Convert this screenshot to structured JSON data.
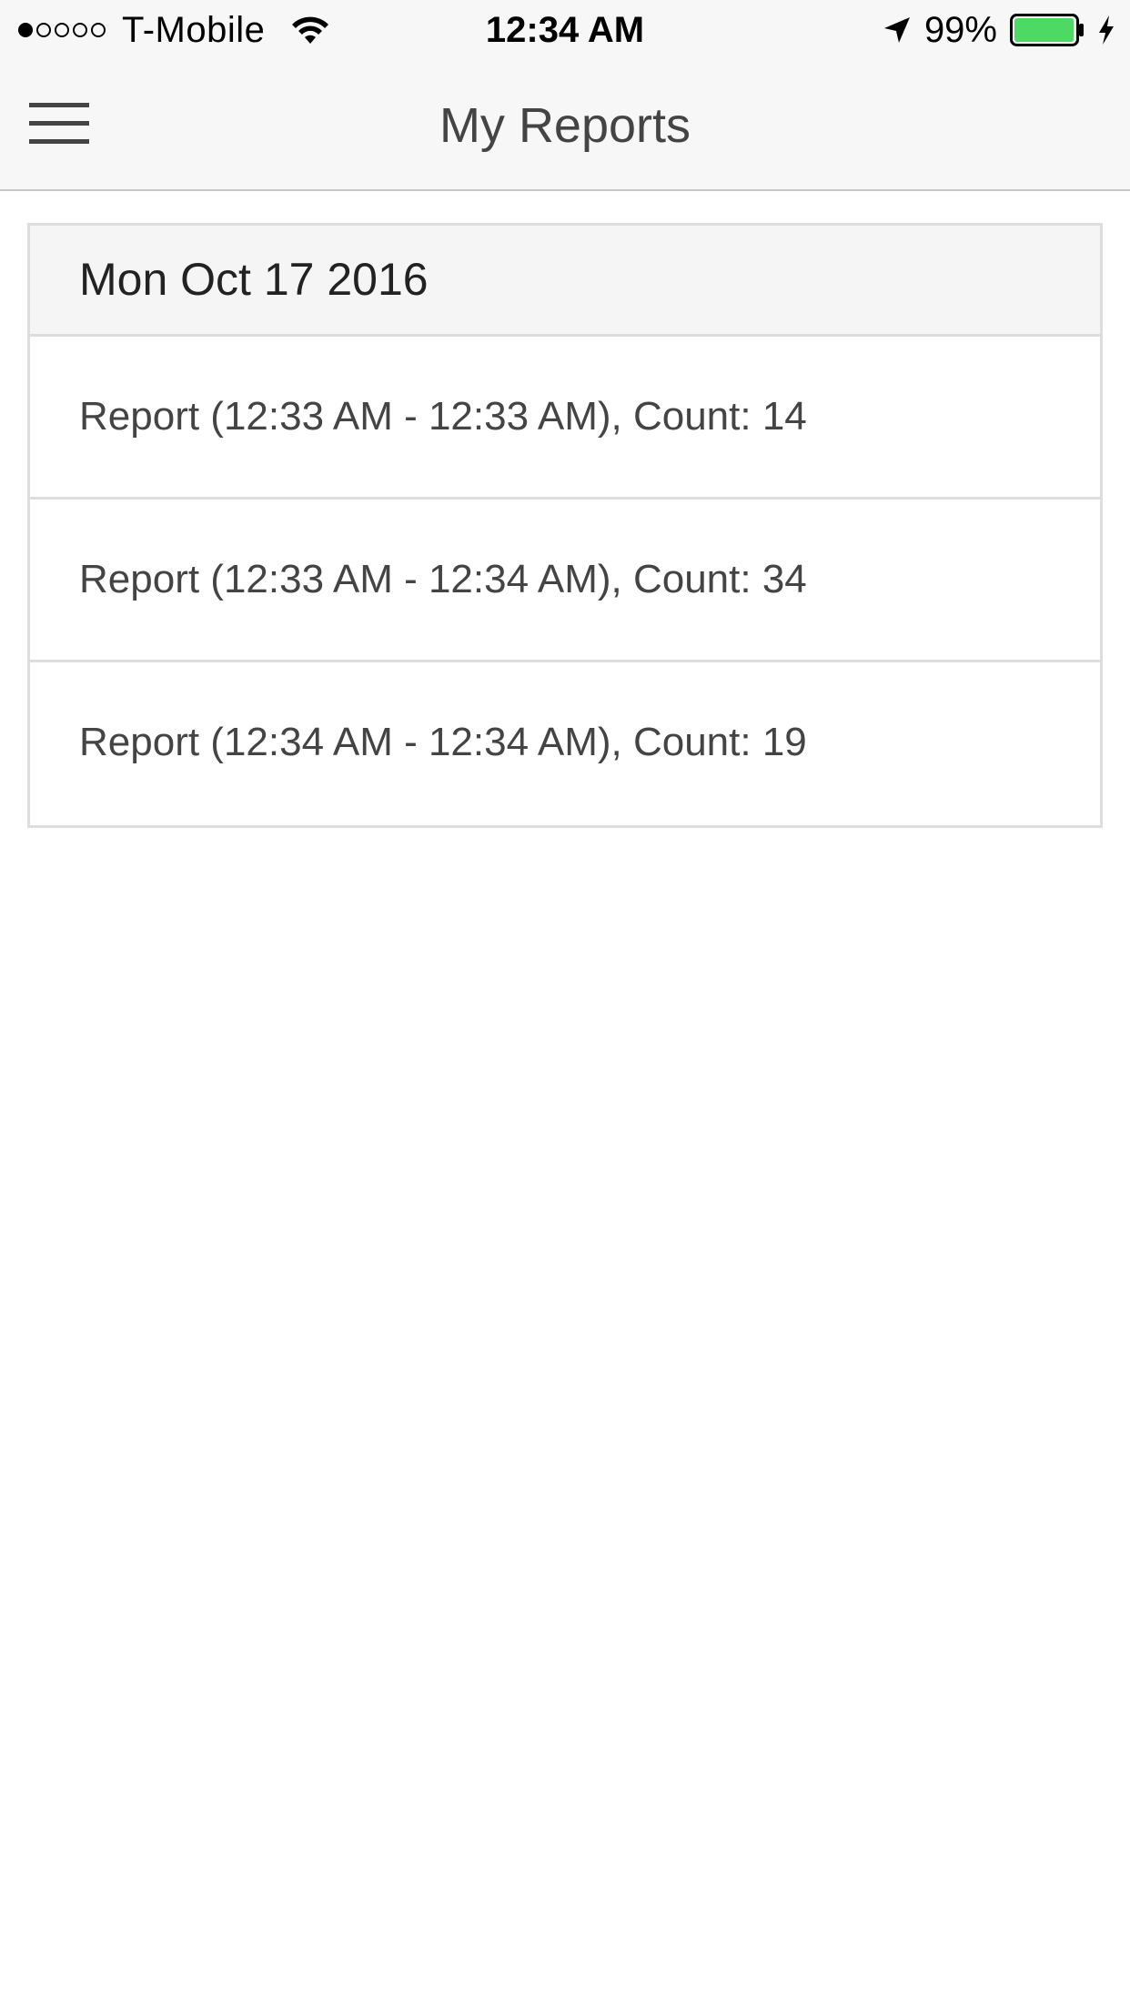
{
  "status_bar": {
    "signal_strength": 1,
    "signal_max": 5,
    "carrier": "T-Mobile",
    "time": "12:34 AM",
    "battery_percent": "99%",
    "battery_level": 0.99,
    "battery_color": "#4cd964",
    "icons": [
      "wifi-icon",
      "location-arrow-icon",
      "battery-icon",
      "charging-bolt-icon"
    ]
  },
  "nav": {
    "title": "My Reports",
    "menu_icon": "hamburger-icon"
  },
  "reports": {
    "date_header": "Mon Oct 17 2016",
    "items": [
      {
        "label": "Report (12:33 AM - 12:33 AM), Count: 14"
      },
      {
        "label": "Report (12:33 AM - 12:34 AM), Count: 34"
      },
      {
        "label": "Report (12:34 AM - 12:34 AM), Count: 19"
      }
    ]
  },
  "colors": {
    "nav_background": "#f7f7f7",
    "header_background": "#f5f5f5",
    "border": "#dddddd",
    "text": "#444444"
  }
}
